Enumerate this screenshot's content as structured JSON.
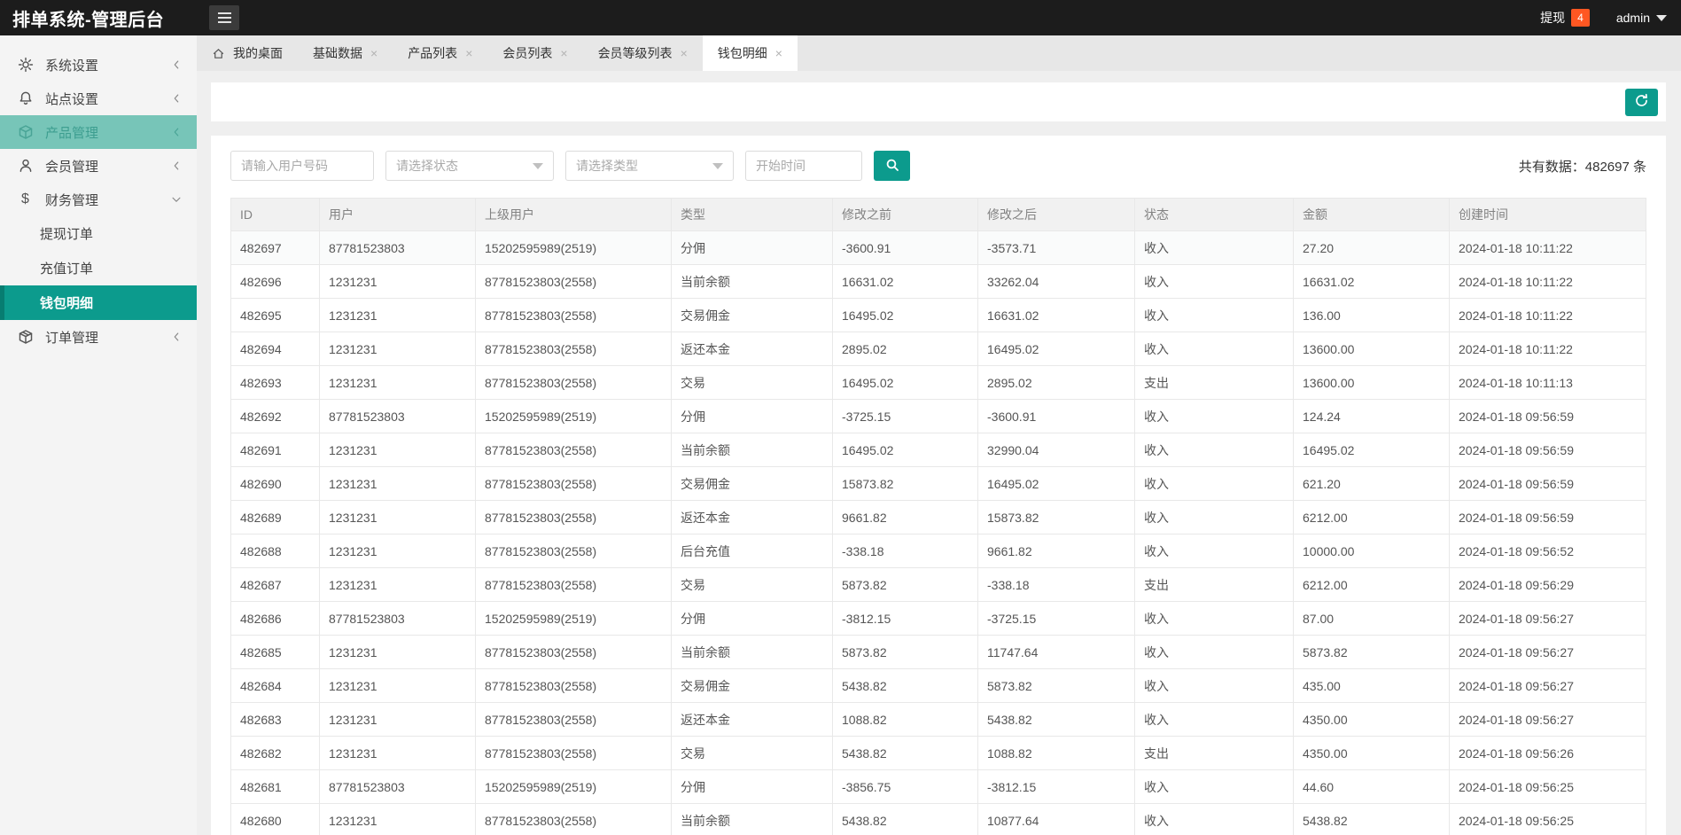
{
  "colors": {
    "accent_teal": "#0c9b8d",
    "hover_teal": "#77c5b8",
    "badge_orange": "#ff5722",
    "navbar_dark": "#1c1c1c"
  },
  "navbar": {
    "title": "排单系统-管理后台",
    "withdraw_label": "提现",
    "withdraw_badge": "4",
    "username": "admin"
  },
  "sidebar": {
    "items": [
      {
        "label": "系统设置",
        "icon": "gear-icon"
      },
      {
        "label": "站点设置",
        "icon": "bell-icon"
      },
      {
        "label": "产品管理",
        "icon": "cube-icon"
      },
      {
        "label": "会员管理",
        "icon": "user-icon"
      },
      {
        "label": "财务管理",
        "icon": "dollar-icon",
        "children": [
          "提现订单",
          "充值订单",
          "钱包明细"
        ]
      },
      {
        "label": "订单管理",
        "icon": "package-icon"
      }
    ],
    "active_child": "钱包明细"
  },
  "tabs": {
    "items": [
      {
        "label": "我的桌面"
      },
      {
        "label": "基础数据"
      },
      {
        "label": "产品列表"
      },
      {
        "label": "会员列表"
      },
      {
        "label": "会员等级列表"
      },
      {
        "label": "钱包明细"
      }
    ],
    "close_glyph": "×"
  },
  "filters": {
    "user_placeholder": "请输入用户号码",
    "status_placeholder": "请选择状态",
    "type_placeholder": "请选择类型",
    "date_placeholder": "开始时间"
  },
  "summary": {
    "total_text": "共有数据：482697 条"
  },
  "table": {
    "headers": [
      "ID",
      "用户",
      "上级用户",
      "类型",
      "修改之前",
      "修改之后",
      "状态",
      "金额",
      "创建时间"
    ],
    "rows": [
      {
        "id": "482697",
        "user": "87781523803",
        "parent": "15202595989(2519)",
        "type": "分佣",
        "before": "-3600.91",
        "after": "-3573.71",
        "status": "收入",
        "amount": "27.20",
        "created": "2024-01-18 10:11:22"
      },
      {
        "id": "482696",
        "user": "1231231",
        "parent": "87781523803(2558)",
        "type": "当前余额",
        "before": "16631.02",
        "after": "33262.04",
        "status": "收入",
        "amount": "16631.02",
        "created": "2024-01-18 10:11:22"
      },
      {
        "id": "482695",
        "user": "1231231",
        "parent": "87781523803(2558)",
        "type": "交易佣金",
        "before": "16495.02",
        "after": "16631.02",
        "status": "收入",
        "amount": "136.00",
        "created": "2024-01-18 10:11:22"
      },
      {
        "id": "482694",
        "user": "1231231",
        "parent": "87781523803(2558)",
        "type": "返还本金",
        "before": "2895.02",
        "after": "16495.02",
        "status": "收入",
        "amount": "13600.00",
        "created": "2024-01-18 10:11:22"
      },
      {
        "id": "482693",
        "user": "1231231",
        "parent": "87781523803(2558)",
        "type": "交易",
        "before": "16495.02",
        "after": "2895.02",
        "status": "支出",
        "amount": "13600.00",
        "created": "2024-01-18 10:11:13"
      },
      {
        "id": "482692",
        "user": "87781523803",
        "parent": "15202595989(2519)",
        "type": "分佣",
        "before": "-3725.15",
        "after": "-3600.91",
        "status": "收入",
        "amount": "124.24",
        "created": "2024-01-18 09:56:59"
      },
      {
        "id": "482691",
        "user": "1231231",
        "parent": "87781523803(2558)",
        "type": "当前余额",
        "before": "16495.02",
        "after": "32990.04",
        "status": "收入",
        "amount": "16495.02",
        "created": "2024-01-18 09:56:59"
      },
      {
        "id": "482690",
        "user": "1231231",
        "parent": "87781523803(2558)",
        "type": "交易佣金",
        "before": "15873.82",
        "after": "16495.02",
        "status": "收入",
        "amount": "621.20",
        "created": "2024-01-18 09:56:59"
      },
      {
        "id": "482689",
        "user": "1231231",
        "parent": "87781523803(2558)",
        "type": "返还本金",
        "before": "9661.82",
        "after": "15873.82",
        "status": "收入",
        "amount": "6212.00",
        "created": "2024-01-18 09:56:59"
      },
      {
        "id": "482688",
        "user": "1231231",
        "parent": "87781523803(2558)",
        "type": "后台充值",
        "before": "-338.18",
        "after": "9661.82",
        "status": "收入",
        "amount": "10000.00",
        "created": "2024-01-18 09:56:52"
      },
      {
        "id": "482687",
        "user": "1231231",
        "parent": "87781523803(2558)",
        "type": "交易",
        "before": "5873.82",
        "after": "-338.18",
        "status": "支出",
        "amount": "6212.00",
        "created": "2024-01-18 09:56:29"
      },
      {
        "id": "482686",
        "user": "87781523803",
        "parent": "15202595989(2519)",
        "type": "分佣",
        "before": "-3812.15",
        "after": "-3725.15",
        "status": "收入",
        "amount": "87.00",
        "created": "2024-01-18 09:56:27"
      },
      {
        "id": "482685",
        "user": "1231231",
        "parent": "87781523803(2558)",
        "type": "当前余额",
        "before": "5873.82",
        "after": "11747.64",
        "status": "收入",
        "amount": "5873.82",
        "created": "2024-01-18 09:56:27"
      },
      {
        "id": "482684",
        "user": "1231231",
        "parent": "87781523803(2558)",
        "type": "交易佣金",
        "before": "5438.82",
        "after": "5873.82",
        "status": "收入",
        "amount": "435.00",
        "created": "2024-01-18 09:56:27"
      },
      {
        "id": "482683",
        "user": "1231231",
        "parent": "87781523803(2558)",
        "type": "返还本金",
        "before": "1088.82",
        "after": "5438.82",
        "status": "收入",
        "amount": "4350.00",
        "created": "2024-01-18 09:56:27"
      },
      {
        "id": "482682",
        "user": "1231231",
        "parent": "87781523803(2558)",
        "type": "交易",
        "before": "5438.82",
        "after": "1088.82",
        "status": "支出",
        "amount": "4350.00",
        "created": "2024-01-18 09:56:26"
      },
      {
        "id": "482681",
        "user": "87781523803",
        "parent": "15202595989(2519)",
        "type": "分佣",
        "before": "-3856.75",
        "after": "-3812.15",
        "status": "收入",
        "amount": "44.60",
        "created": "2024-01-18 09:56:25"
      },
      {
        "id": "482680",
        "user": "1231231",
        "parent": "87781523803(2558)",
        "type": "当前余额",
        "before": "5438.82",
        "after": "10877.64",
        "status": "收入",
        "amount": "5438.82",
        "created": "2024-01-18 09:56:25"
      }
    ]
  }
}
